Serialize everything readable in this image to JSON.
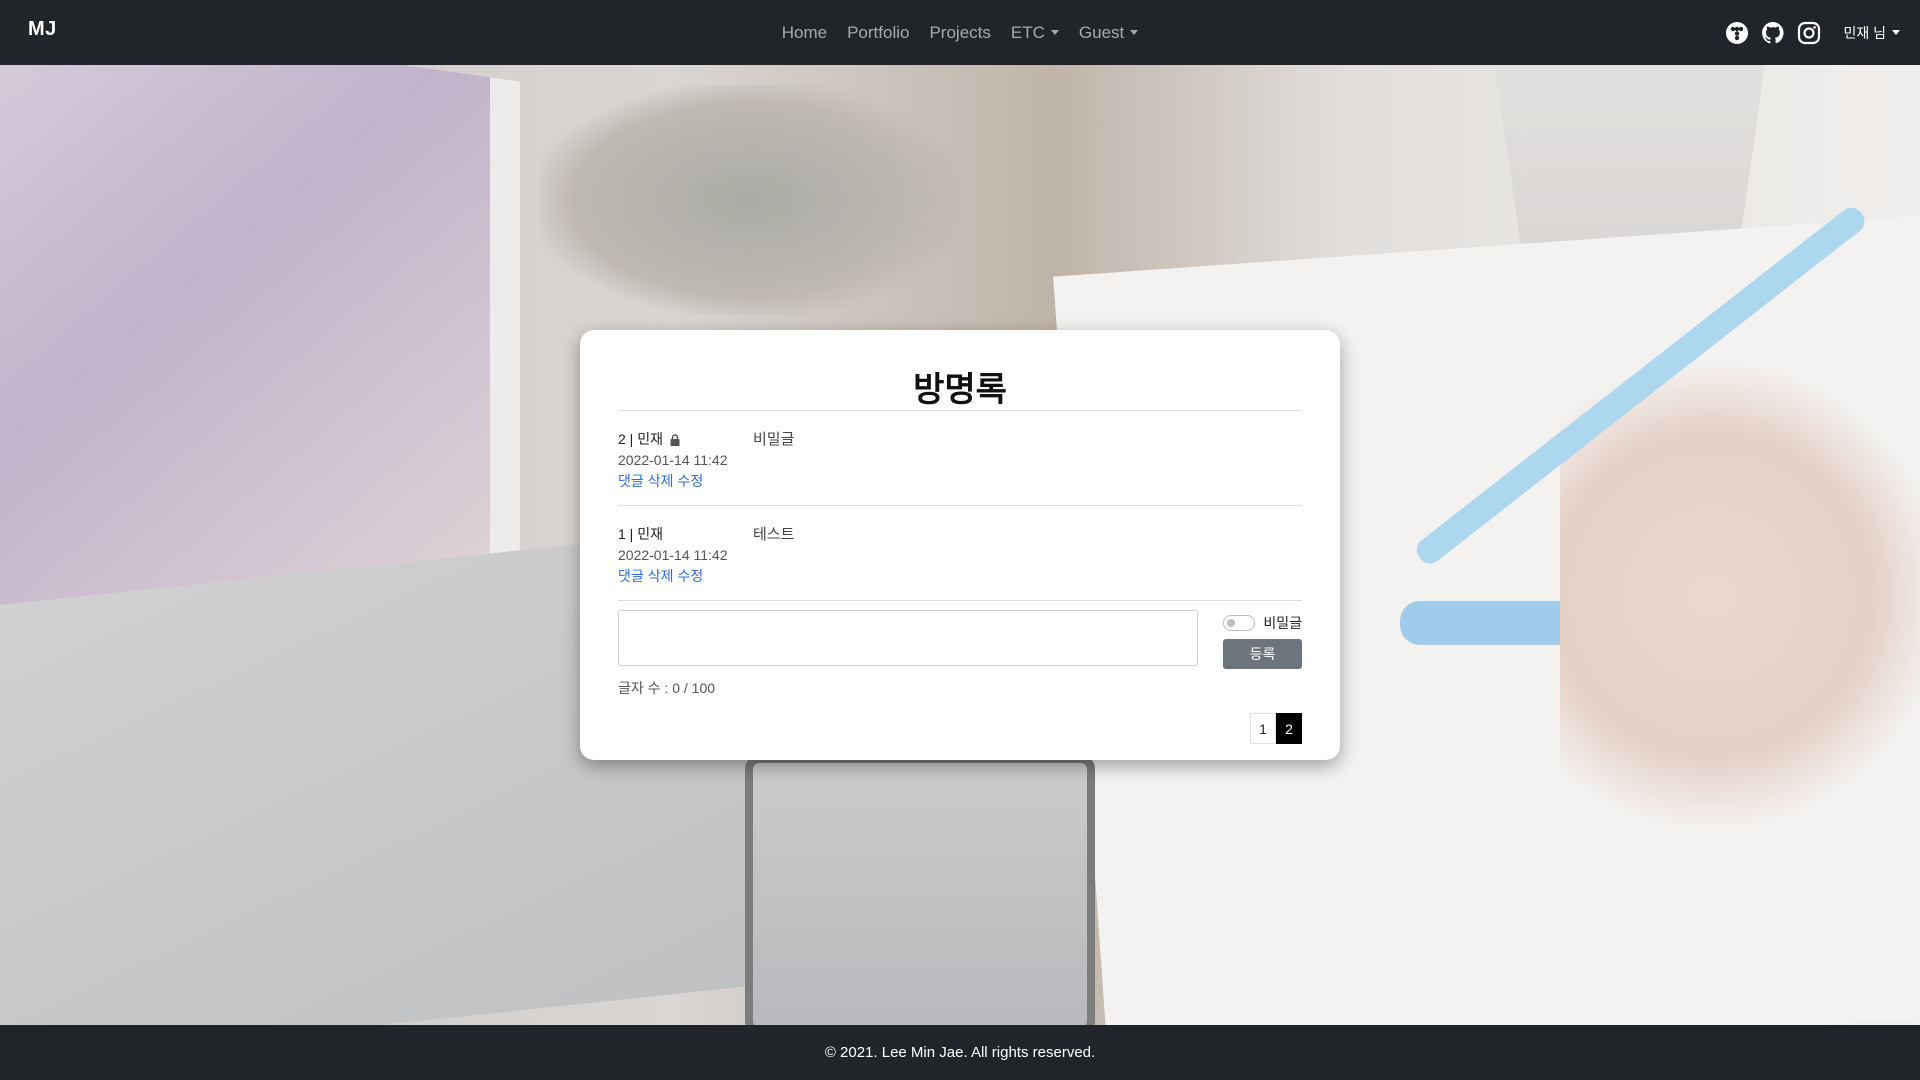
{
  "navbar": {
    "brand": "MJ",
    "links": [
      "Home",
      "Portfolio",
      "Projects"
    ],
    "dropdowns": [
      "ETC",
      "Guest"
    ],
    "user_menu": "민재 님",
    "social_icons": [
      "tistory-icon",
      "github-icon",
      "instagram-icon"
    ]
  },
  "guestbook": {
    "title": "방명록",
    "entries": [
      {
        "header": "2 | 민재",
        "locked": true,
        "date": "2022-01-14 11:42",
        "reply": "댓글",
        "delete": "삭제",
        "edit": "수정",
        "content": "비밀글"
      },
      {
        "header": "1 | 민재",
        "locked": false,
        "date": "2022-01-14 11:42",
        "reply": "댓글",
        "delete": "삭제",
        "edit": "수정",
        "content": "테스트"
      }
    ],
    "form": {
      "text_value": "",
      "char_count": "글자 수 : 0 / 100",
      "secret_label": "비밀글",
      "secret_checked": false,
      "submit_label": "등록"
    },
    "pagination": [
      "1",
      "2"
    ],
    "current_page": "2"
  },
  "footer": {
    "copyright": "© 2021. Lee Min Jae. All rights reserved."
  },
  "colors": {
    "navbar_bg": "#212529",
    "link_blue": "#2f6fe4",
    "button_gray": "#6c757d"
  }
}
